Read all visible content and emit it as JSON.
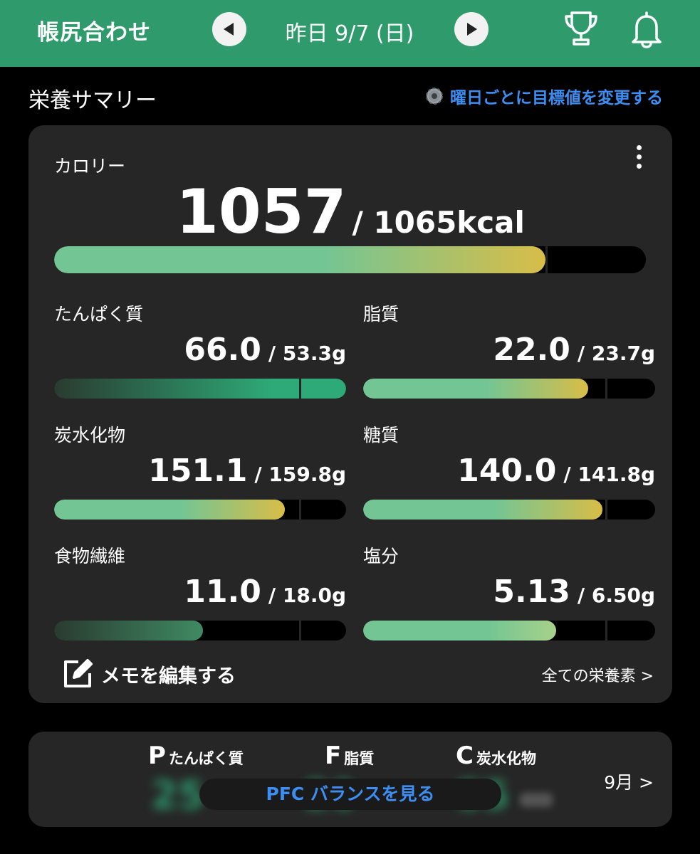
{
  "header": {
    "title": "帳尻合わせ",
    "date": "昨日 9/7 (日)",
    "color": "#2f9a6b"
  },
  "summary": {
    "title": "栄養サマリー",
    "goal_link": "曜日ごとに目標値を変更する"
  },
  "calorie": {
    "label": "カロリー",
    "value": "1057",
    "target": "/ 1065kcal",
    "progress": 0.83
  },
  "nutrients": [
    {
      "label": "たんぱく質",
      "value": "66.0",
      "target": "/ 53.3g",
      "progress": 1.0,
      "goal_mark": 0.84
    },
    {
      "label": "脂質",
      "value": "22.0",
      "target": "/ 23.7g",
      "progress": 0.77,
      "goal_mark": 0.83
    },
    {
      "label": "炭水化物",
      "value": "151.1",
      "target": "/ 159.8g",
      "progress": 0.79,
      "goal_mark": 0.84
    },
    {
      "label": "糖質",
      "value": "140.0",
      "target": "/ 141.8g",
      "progress": 0.82,
      "goal_mark": 0.83
    },
    {
      "label": "食物繊維",
      "value": "11.0",
      "target": "/ 18.0g",
      "progress": 0.51,
      "goal_mark": 0.84
    },
    {
      "label": "塩分",
      "value": "5.13",
      "target": "/ 6.50g",
      "progress": 0.66,
      "goal_mark": 0.83
    }
  ],
  "memo_label": "メモを編集する",
  "all_nutrients_link": "全ての栄養素 >",
  "pfc": {
    "p_letter": "P",
    "p_name": "たんぱく質",
    "f_letter": "F",
    "f_name": "脂質",
    "c_letter": "C",
    "c_name": "炭水化物",
    "button": "PFC バランスを見る",
    "month_link": "9月 >"
  }
}
